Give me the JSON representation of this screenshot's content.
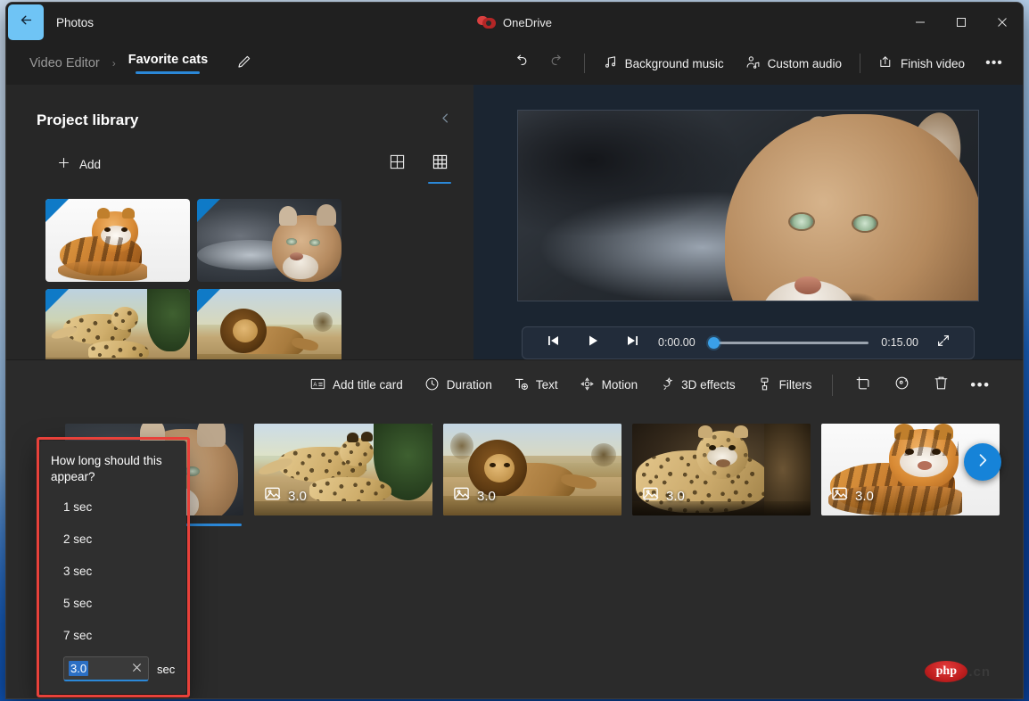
{
  "app": {
    "name": "Photos",
    "onedrive_label": "OneDrive",
    "back_icon": "back-arrow-icon",
    "minimize_label": "–",
    "maximize_label": "□",
    "close_label": "✕"
  },
  "breadcrumb": {
    "parent": "Video Editor",
    "separator": "›",
    "current": "Favorite cats",
    "edit_icon": "pencil-icon"
  },
  "commandbar": {
    "undo_icon": "undo-icon",
    "redo_icon": "redo-icon",
    "buttons": [
      {
        "label": "Background music",
        "icon": "music-note-icon",
        "enabled": true
      },
      {
        "label": "Custom audio",
        "icon": "person-audio-icon",
        "enabled": true
      },
      {
        "label": "Finish video",
        "icon": "export-icon",
        "enabled": true
      }
    ],
    "overflow_label": "•••"
  },
  "library": {
    "title": "Project library",
    "collapse_icon": "chevron-left-icon",
    "add_label": "Add",
    "add_icon": "plus-icon",
    "view_small_icon": "grid-small-icon",
    "view_large_icon": "grid-large-icon",
    "active_view": "grid-large",
    "items": [
      {
        "name": "tiger",
        "alt": "Tiger on white background",
        "selected": true
      },
      {
        "name": "cougar",
        "alt": "Cougar close-up portrait",
        "selected": true
      },
      {
        "name": "cheetahs",
        "alt": "Two cheetahs in savanna",
        "selected": true
      },
      {
        "name": "lion",
        "alt": "Lion standing in dry grassland",
        "selected": true
      },
      {
        "name": "leopard",
        "alt": "Leopard resting",
        "selected": true
      }
    ]
  },
  "duration_popup": {
    "question": "How long should this appear?",
    "options": [
      "1 sec",
      "2 sec",
      "3 sec",
      "5 sec",
      "7 sec"
    ],
    "custom_value": "3.0",
    "custom_unit": "sec",
    "clear_icon": "close-icon",
    "highlight_color": "#e8413a"
  },
  "preview": {
    "current_frame_alt": "Cougar close-up portrait",
    "controls": {
      "prev_frame_icon": "step-back-icon",
      "play_icon": "play-icon",
      "next_frame_icon": "step-forward-icon",
      "current_time": "0:00.00",
      "total_time": "0:15.00",
      "progress_percent": 0,
      "fullscreen_icon": "expand-icon"
    }
  },
  "story_toolbar": {
    "buttons": [
      {
        "label": "Add title card",
        "icon": "title-card-icon"
      },
      {
        "label": "Duration",
        "icon": "clock-icon"
      },
      {
        "label": "Text",
        "icon": "text-icon"
      },
      {
        "label": "Motion",
        "icon": "motion-icon"
      },
      {
        "label": "3D effects",
        "icon": "sparkle-icon"
      },
      {
        "label": "Filters",
        "icon": "filter-icon"
      }
    ],
    "icon_buttons": [
      {
        "icon": "crop-icon",
        "name": "crop-button"
      },
      {
        "icon": "rotate-icon",
        "name": "rotate-button"
      },
      {
        "icon": "trash-icon",
        "name": "delete-button"
      },
      {
        "icon": "more-icon",
        "name": "more-options-button"
      }
    ]
  },
  "storyboard": {
    "clips": [
      {
        "name": "cougar",
        "duration": "3.0",
        "icon": "image-icon",
        "selected": true
      },
      {
        "name": "cheetahs",
        "duration": "3.0",
        "icon": "image-icon",
        "selected": false
      },
      {
        "name": "lion",
        "duration": "3.0",
        "icon": "image-icon",
        "selected": false
      },
      {
        "name": "leopard",
        "duration": "3.0",
        "icon": "image-icon",
        "selected": false
      },
      {
        "name": "tiger",
        "duration": "3.0",
        "icon": "image-icon",
        "selected": false
      }
    ],
    "next_arrow_icon": "chevron-right-icon"
  },
  "watermark": {
    "badge": "php",
    "suffix": ".cn"
  },
  "colors": {
    "accent": "#2b88d8",
    "window_bg": "#272727",
    "titlebar_bg": "#202020",
    "preview_bg": "#1b2531",
    "storyboard_bg": "#2b2b2b",
    "highlight_red": "#e8413a",
    "flag_blue": "#0f7ac7"
  }
}
